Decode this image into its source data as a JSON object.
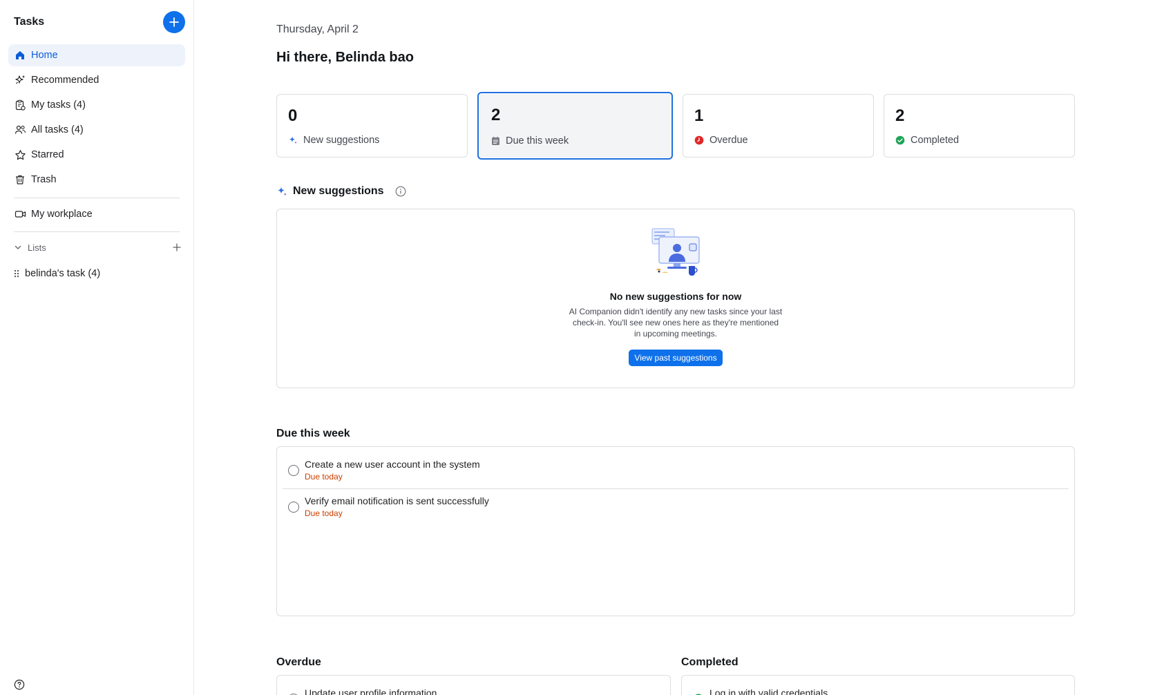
{
  "sidebar": {
    "title": "Tasks",
    "items": [
      {
        "label": "Home",
        "icon": "home-icon"
      },
      {
        "label": "Recommended",
        "icon": "sparkle-icon"
      },
      {
        "label": "My tasks (4)",
        "icon": "clipboard-icon"
      },
      {
        "label": "All tasks (4)",
        "icon": "users-icon"
      },
      {
        "label": "Starred",
        "icon": "star-icon"
      },
      {
        "label": "Trash",
        "icon": "trash-icon"
      }
    ],
    "workplace": {
      "label": "My workplace",
      "icon": "video-icon"
    },
    "lists_label": "Lists",
    "list_items": [
      {
        "label": "belinda's task (4)"
      }
    ]
  },
  "main": {
    "date": "Thursday, April 2",
    "greeting": "Hi there, Belinda bao",
    "cards": [
      {
        "count": "0",
        "label": "New suggestions"
      },
      {
        "count": "2",
        "label": "Due this week"
      },
      {
        "count": "1",
        "label": "Overdue"
      },
      {
        "count": "2",
        "label": "Completed"
      }
    ],
    "suggestions": {
      "title": "New suggestions",
      "empty_title": "No new suggestions for now",
      "empty_desc": "AI Companion didn't identify any new tasks since your last check-in. You'll see new ones here as they're mentioned in upcoming meetings.",
      "button": "View past suggestions"
    },
    "due_week": {
      "title": "Due this week",
      "tasks": [
        {
          "title": "Create a new user account in the system",
          "due": "Due today"
        },
        {
          "title": "Verify email notification is sent successfully",
          "due": "Due today"
        }
      ]
    },
    "overdue": {
      "title": "Overdue",
      "tasks": [
        {
          "title": "Update user profile information"
        }
      ]
    },
    "completed": {
      "title": "Completed",
      "tasks": [
        {
          "title": "Log in with valid credentials"
        }
      ]
    }
  },
  "colors": {
    "accent": "#0e71eb",
    "overdue": "#e02828",
    "completed": "#1da557",
    "due": "#c94100"
  }
}
